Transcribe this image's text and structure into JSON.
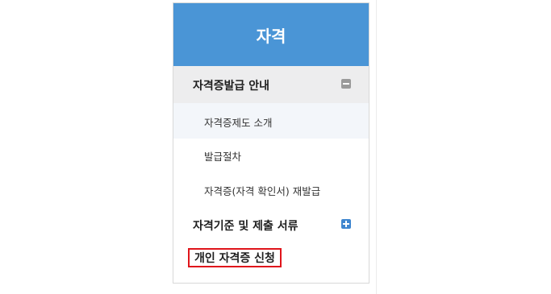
{
  "header": {
    "title": "자격"
  },
  "menu": {
    "section1": {
      "label": "자격증발급 안내",
      "toggle_icon": "minus-icon",
      "items": [
        {
          "label": "자격증제도 소개"
        },
        {
          "label": "발급절차"
        },
        {
          "label": "자격증(자격 확인서) 재발급"
        }
      ]
    },
    "section2": {
      "label": "자격기준 및 제출 서류",
      "toggle_icon": "plus-icon"
    },
    "section3": {
      "label": "개인 자격증 신청"
    }
  },
  "colors": {
    "header_bg": "#4a95d6",
    "active_section_bg": "#ededee",
    "highlight_border": "#e0151b",
    "plus_icon": "#3f86cf"
  }
}
